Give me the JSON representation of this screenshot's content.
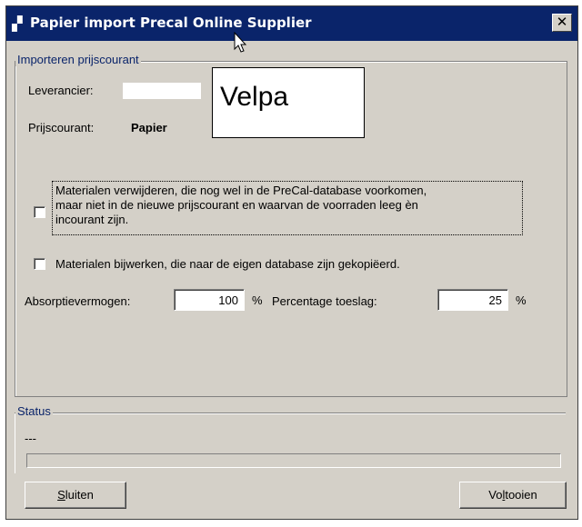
{
  "window": {
    "title": "Papier import Precal Online Supplier",
    "close_label": "✕"
  },
  "import_group": {
    "caption": "Importeren prijscourant",
    "supplier_label": "Leverancier:",
    "supplier_overlay": "Velpa",
    "pricelist_label": "Prijscourant:",
    "pricelist_value": "Papier",
    "remove_materials": {
      "checked": false,
      "lines": [
        "Materialen verwijderen, die nog wel in de PreCal-database voorkomen,",
        "maar niet in de nieuwe prijscourant en waarvan de voorraden leeg èn",
        "incourant zijn."
      ]
    },
    "update_materials": {
      "checked": false,
      "label": "Materialen bijwerken, die naar de eigen database zijn gekopiëerd."
    },
    "absorption_label": "Absorptievermogen:",
    "absorption_value": "100",
    "absorption_unit": "%",
    "surcharge_label": "Percentage toeslag:",
    "surcharge_value": "25",
    "surcharge_unit": "%"
  },
  "status_group": {
    "caption": "Status",
    "text": "---"
  },
  "buttons": {
    "close_mnemonic": "S",
    "close_rest": "luiten",
    "finish_pre": "Vo",
    "finish_mnemonic": "l",
    "finish_rest": "tooien"
  }
}
